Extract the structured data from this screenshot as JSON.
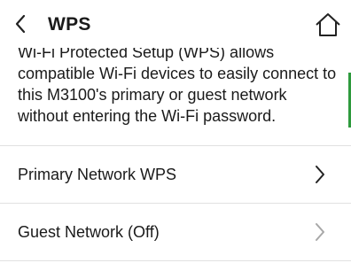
{
  "header": {
    "title": "WPS",
    "back_icon": "chevron-left-icon",
    "home_icon": "home-icon"
  },
  "description": "Wi-Fi Protected Setup (WPS) allows compatible Wi-Fi devices to easily connect to this M3100's primary or guest network without entering the Wi-Fi password.",
  "menu": [
    {
      "label": "Primary Network WPS",
      "enabled": true,
      "icon": "chevron-right-icon"
    },
    {
      "label": "Guest Network (Off)",
      "enabled": false,
      "icon": "chevron-right-icon"
    }
  ],
  "colors": {
    "scroll_indicator": "#2e9a3d",
    "chevron_enabled": "#222222",
    "chevron_disabled": "#a8a8a8"
  }
}
